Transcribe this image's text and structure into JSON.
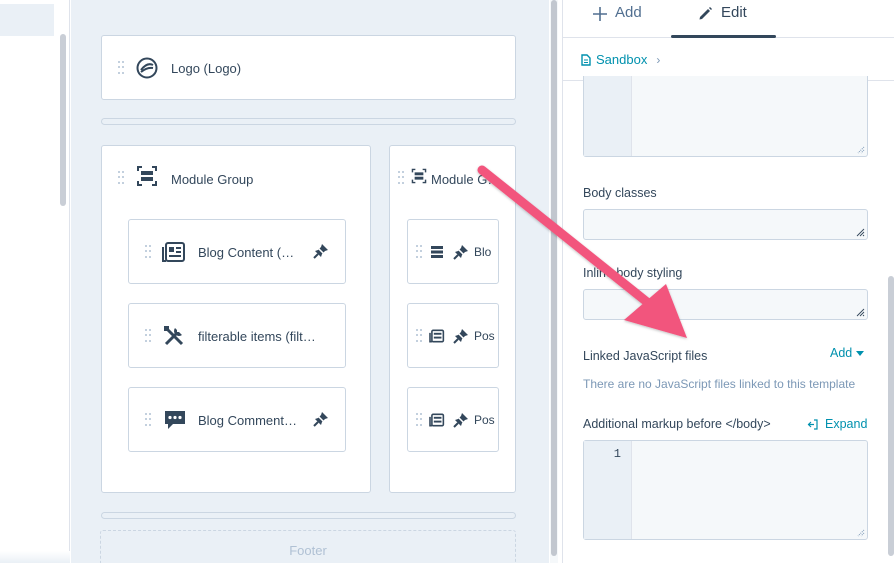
{
  "canvas": {
    "logo_module": {
      "label": "Logo (Logo)"
    },
    "group_left": {
      "label": "Module Group",
      "items": [
        {
          "label": "Blog Content (…",
          "icon": "blog-content-icon"
        },
        {
          "label": "filterable items (filt…",
          "icon": "tools-icon"
        },
        {
          "label": "Blog Comment…",
          "icon": "comment-icon"
        }
      ]
    },
    "group_right": {
      "label": "Module G…",
      "items": [
        {
          "label": "Blo"
        },
        {
          "label": "Pos"
        },
        {
          "label": "Pos"
        }
      ]
    },
    "footer_label": "Footer"
  },
  "panel": {
    "tabs": {
      "add": "Add",
      "edit": "Edit"
    },
    "breadcrumb": "Sandbox",
    "body_classes_label": "Body classes",
    "inline_styling_label": "Inline body styling",
    "linked_js": {
      "label": "Linked JavaScript files",
      "add_label": "Add",
      "empty_text": "There are no JavaScript files linked to this template"
    },
    "markup": {
      "label": "Additional markup before </body>",
      "expand_label": "Expand",
      "line_number": "1"
    }
  },
  "colors": {
    "accent": "#0091ae",
    "annotation_arrow": "#f2547d"
  }
}
